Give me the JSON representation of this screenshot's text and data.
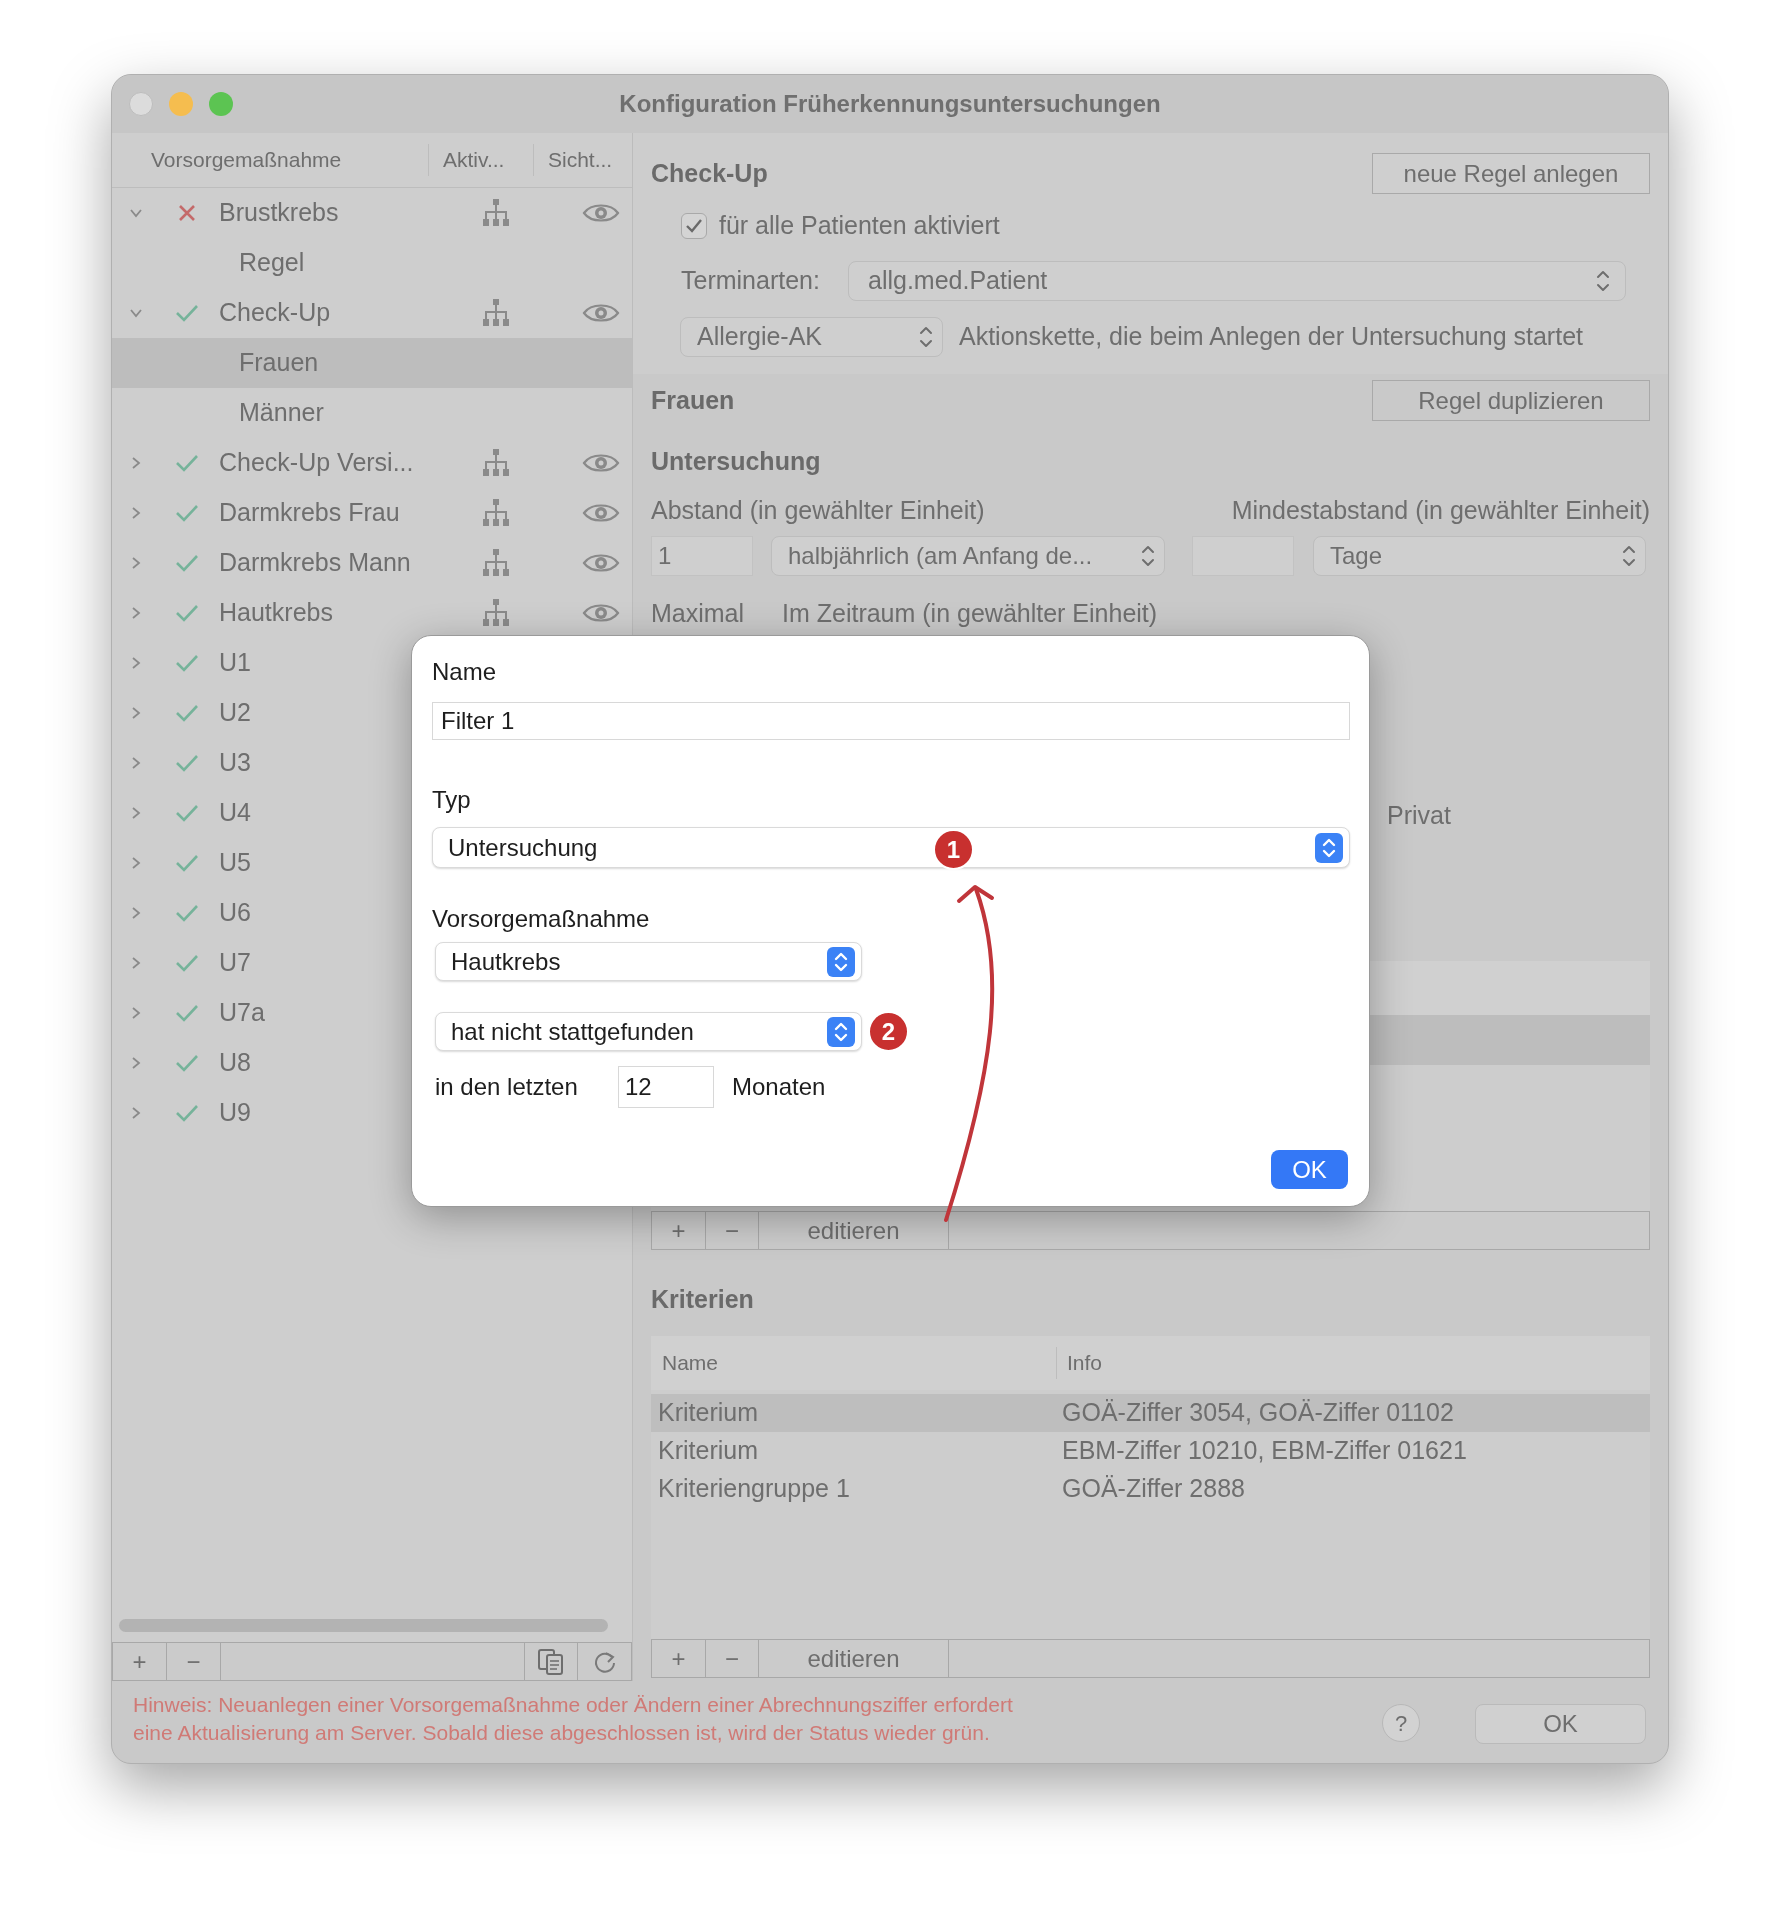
{
  "window": {
    "title": "Konfiguration Früherkennungsuntersuchungen"
  },
  "sidebar": {
    "columns": [
      "Vorsorgemaßnahme",
      "Aktiv...",
      "Sicht..."
    ],
    "items": [
      {
        "label": "Brustkrebs",
        "valid": false,
        "expanded": true,
        "selected": false,
        "icons_shown": true,
        "children": [
          {
            "label": "Regel",
            "selected": false
          }
        ]
      },
      {
        "label": "Check-Up",
        "valid": true,
        "expanded": true,
        "selected": false,
        "icons_shown": true,
        "children": [
          {
            "label": "Frauen",
            "selected": true
          },
          {
            "label": "Männer",
            "selected": false
          }
        ]
      },
      {
        "label": "Check-Up Versi...",
        "valid": true,
        "expanded": false,
        "selected": false,
        "icons_shown": true
      },
      {
        "label": "Darmkrebs Frau",
        "valid": true,
        "expanded": false,
        "selected": false,
        "icons_shown": true
      },
      {
        "label": "Darmkrebs Mann",
        "valid": true,
        "expanded": false,
        "selected": false,
        "icons_shown": true
      },
      {
        "label": "Hautkrebs",
        "valid": true,
        "expanded": false,
        "selected": false,
        "icons_shown": true
      },
      {
        "label": "U1",
        "valid": true,
        "expanded": false,
        "selected": false,
        "icons_shown": false
      },
      {
        "label": "U2",
        "valid": true,
        "expanded": false,
        "selected": false,
        "icons_shown": false
      },
      {
        "label": "U3",
        "valid": true,
        "expanded": false,
        "selected": false,
        "icons_shown": false
      },
      {
        "label": "U4",
        "valid": true,
        "expanded": false,
        "selected": false,
        "icons_shown": false
      },
      {
        "label": "U5",
        "valid": true,
        "expanded": false,
        "selected": false,
        "icons_shown": false
      },
      {
        "label": "U6",
        "valid": true,
        "expanded": false,
        "selected": false,
        "icons_shown": false
      },
      {
        "label": "U7",
        "valid": true,
        "expanded": false,
        "selected": false,
        "icons_shown": false
      },
      {
        "label": "U7a",
        "valid": true,
        "expanded": false,
        "selected": false,
        "icons_shown": false
      },
      {
        "label": "U8",
        "valid": true,
        "expanded": false,
        "selected": false,
        "icons_shown": false
      },
      {
        "label": "U9",
        "valid": true,
        "expanded": false,
        "selected": false,
        "icons_shown": false
      }
    ],
    "toolbar": [
      "+",
      "−"
    ]
  },
  "rule_set": {
    "title": "Check-Up",
    "new_rule_button": "neue Regel anlegen",
    "activate_all": {
      "label": "für alle Patienten aktiviert",
      "checked": true
    },
    "appointment_types": {
      "label": "Terminarten:",
      "value": "allg.med.Patient"
    },
    "action_chain": {
      "value": "Allergie-AK",
      "description": "Aktionskette, die beim Anlegen der Untersuchung startet"
    }
  },
  "rule": {
    "title": "Frauen",
    "duplicate_button": "Regel duplizieren",
    "section": "Untersuchung",
    "interval": {
      "label": "Abstand (in gewählter Einheit)",
      "value": "1",
      "unit": "halbjährlich (am Anfang de..."
    },
    "min_interval": {
      "label": "Mindestabstand (in gewählter Einheit)",
      "unit": "Tage"
    },
    "maximal_label": "Maximal",
    "period_label": "Im Zeitraum (in gewählter Einheit)",
    "private_label": "Privat",
    "filter_toolbar": [
      "+",
      "−",
      "editieren"
    ]
  },
  "criteria": {
    "title": "Kriterien",
    "columns": [
      "Name",
      "Info"
    ],
    "rows": [
      {
        "name": "Kriterium",
        "info": "GOÄ-Ziffer 3054, GOÄ-Ziffer 01102",
        "selected": true
      },
      {
        "name": "Kriterium",
        "info": "EBM-Ziffer 10210, EBM-Ziffer 01621",
        "selected": false
      },
      {
        "name": "Kriteriengruppe 1",
        "info": "GOÄ-Ziffer 2888",
        "selected": false
      }
    ],
    "toolbar": [
      "+",
      "−",
      "editieren"
    ]
  },
  "notice_lines": [
    "Hinweis: Neuanlegen einer Vorsorgemaßnahme oder Ändern einer Abrechnungsziffer erfordert",
    "eine Aktualisierung am Server. Sobald diese abgeschlossen ist, wird der Status wieder grün."
  ],
  "footer": {
    "help": "?",
    "ok": "OK"
  },
  "dialog": {
    "name": {
      "label": "Name",
      "value": "Filter 1"
    },
    "type": {
      "label": "Typ",
      "value": "Untersuchung",
      "badge": "1"
    },
    "measure": {
      "label": "Vorsorgemaßnahme",
      "value": "Hautkrebs"
    },
    "condition": {
      "value": "hat nicht stattgefunden",
      "badge": "2"
    },
    "period": {
      "prefix": "in den letzten",
      "value": "12",
      "suffix": "Monaten"
    },
    "ok": "OK"
  }
}
